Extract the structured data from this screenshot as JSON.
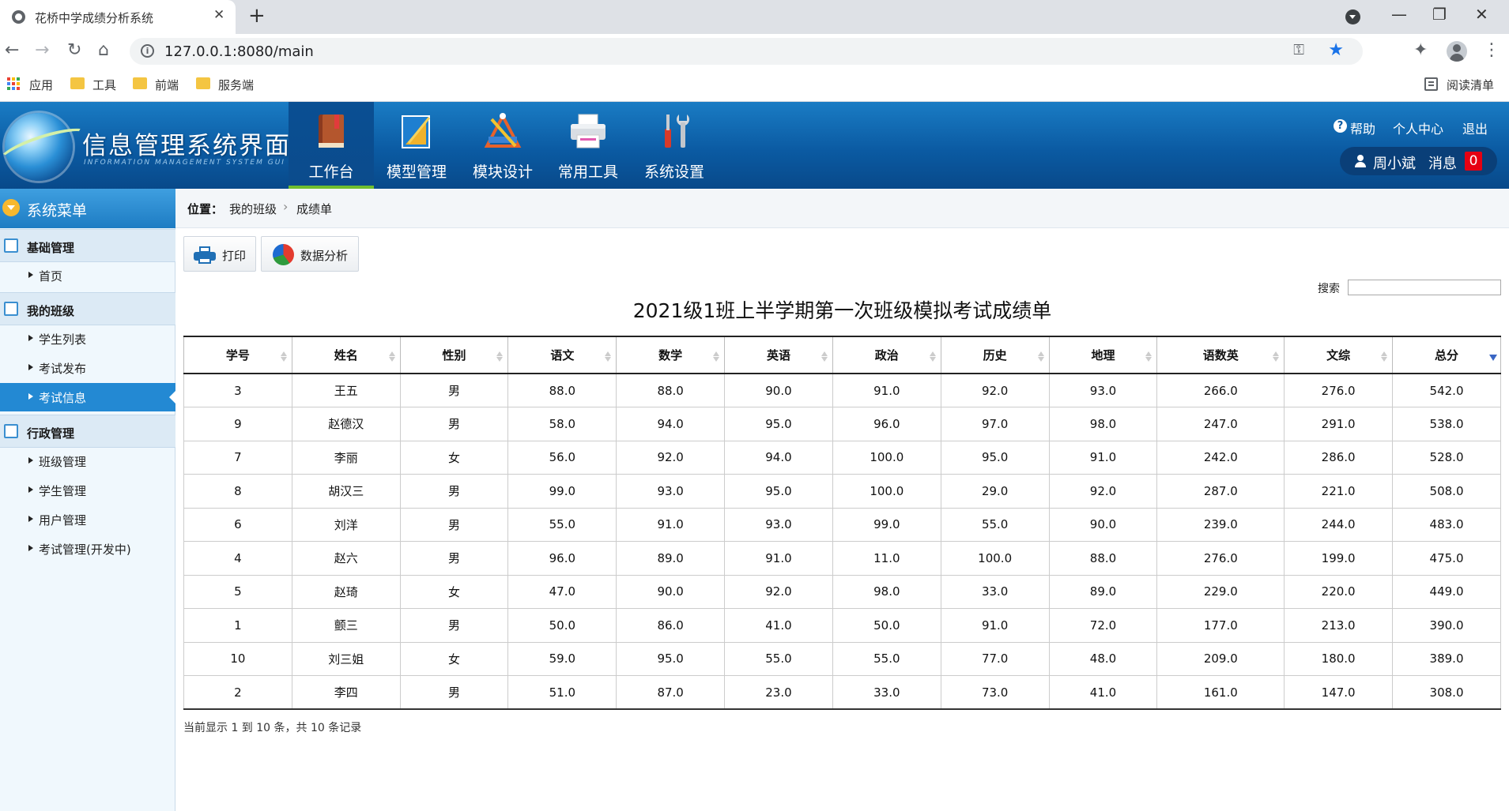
{
  "browser": {
    "tab_title": "花桥中学成绩分析系统",
    "url": "127.0.0.1:8080/main",
    "bookmarks": [
      "应用",
      "工具",
      "前端",
      "服务端"
    ],
    "reading_list": "阅读清单"
  },
  "header": {
    "logo_title": "信息管理系统界面",
    "logo_subtitle": "INFORMATION MANAGEMENT SYSTEM GUI",
    "nav": [
      {
        "label": "工作台"
      },
      {
        "label": "模型管理"
      },
      {
        "label": "模块设计"
      },
      {
        "label": "常用工具"
      },
      {
        "label": "系统设置"
      }
    ],
    "help": "帮助",
    "profile": "个人中心",
    "logout": "退出",
    "username": "周小斌",
    "messages_label": "消息",
    "message_count": "0"
  },
  "sidebar": {
    "title": "系统菜单",
    "groups": [
      {
        "label": "基础管理",
        "items": [
          "首页"
        ]
      },
      {
        "label": "我的班级",
        "items": [
          "学生列表",
          "考试发布",
          "考试信息"
        ]
      },
      {
        "label": "行政管理",
        "items": [
          "班级管理",
          "学生管理",
          "用户管理",
          "考试管理(开发中)"
        ]
      }
    ],
    "active_item": "考试信息"
  },
  "breadcrumb": {
    "label": "位置：",
    "items": [
      "我的班级",
      "成绩单"
    ],
    "separator": "›"
  },
  "toolbar": {
    "print": "打印",
    "analysis": "数据分析"
  },
  "search": {
    "label": "搜索",
    "value": ""
  },
  "table": {
    "title": "2021级1班上半学期第一次班级模拟考试成绩单",
    "columns": [
      "学号",
      "姓名",
      "性别",
      "语文",
      "数学",
      "英语",
      "政治",
      "历史",
      "地理",
      "语数英",
      "文综",
      "总分"
    ],
    "sorted_column": "总分",
    "sort_direction": "desc",
    "rows": [
      [
        "3",
        "王五",
        "男",
        "88.0",
        "88.0",
        "90.0",
        "91.0",
        "92.0",
        "93.0",
        "266.0",
        "276.0",
        "542.0"
      ],
      [
        "9",
        "赵德汉",
        "男",
        "58.0",
        "94.0",
        "95.0",
        "96.0",
        "97.0",
        "98.0",
        "247.0",
        "291.0",
        "538.0"
      ],
      [
        "7",
        "李丽",
        "女",
        "56.0",
        "92.0",
        "94.0",
        "100.0",
        "95.0",
        "91.0",
        "242.0",
        "286.0",
        "528.0"
      ],
      [
        "8",
        "胡汉三",
        "男",
        "99.0",
        "93.0",
        "95.0",
        "100.0",
        "29.0",
        "92.0",
        "287.0",
        "221.0",
        "508.0"
      ],
      [
        "6",
        "刘洋",
        "男",
        "55.0",
        "91.0",
        "93.0",
        "99.0",
        "55.0",
        "90.0",
        "239.0",
        "244.0",
        "483.0"
      ],
      [
        "4",
        "赵六",
        "男",
        "96.0",
        "89.0",
        "91.0",
        "11.0",
        "100.0",
        "88.0",
        "276.0",
        "199.0",
        "475.0"
      ],
      [
        "5",
        "赵琦",
        "女",
        "47.0",
        "90.0",
        "92.0",
        "98.0",
        "33.0",
        "89.0",
        "229.0",
        "220.0",
        "449.0"
      ],
      [
        "1",
        "颤三",
        "男",
        "50.0",
        "86.0",
        "41.0",
        "50.0",
        "91.0",
        "72.0",
        "177.0",
        "213.0",
        "390.0"
      ],
      [
        "10",
        "刘三姐",
        "女",
        "59.0",
        "95.0",
        "55.0",
        "55.0",
        "77.0",
        "48.0",
        "209.0",
        "180.0",
        "389.0"
      ],
      [
        "2",
        "李四",
        "男",
        "51.0",
        "87.0",
        "23.0",
        "33.0",
        "73.0",
        "41.0",
        "161.0",
        "147.0",
        "308.0"
      ]
    ],
    "footer": "当前显示 1 到 10 条，共 10 条记录"
  }
}
